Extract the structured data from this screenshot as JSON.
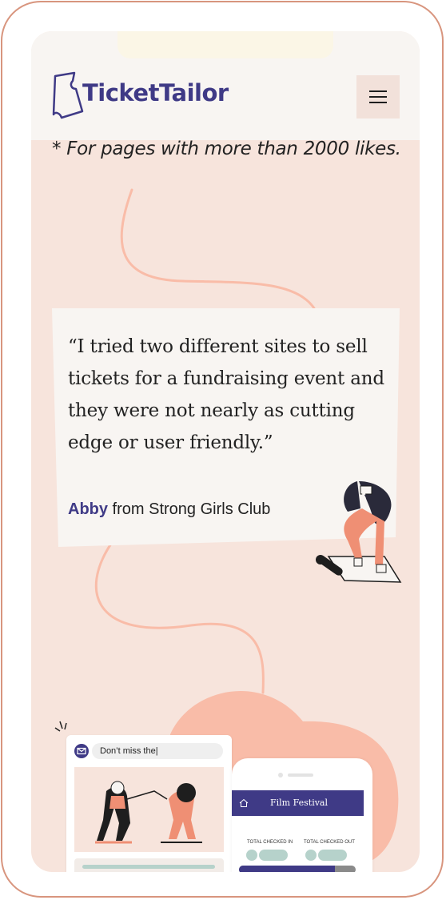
{
  "header": {
    "logo_text": "TicketTailor",
    "menu_icon": "hamburger-icon"
  },
  "footnote": "* For pages with more than 2000 likes.",
  "testimonial": {
    "quote": "“I tried two different sites to sell tickets for a fundraising event and they were not nearly as cutting edge or user friendly.”",
    "author_name": "Abby",
    "author_org": " from Strong Girls Club"
  },
  "email_preview": {
    "subject": "Don’t miss the|",
    "icon": "mail-icon"
  },
  "phone_preview": {
    "title": "Film Festival",
    "home_icon": "home-icon",
    "label_in": "TOTAL CHECKED IN",
    "label_out": "TOTAL CHECKED OUT",
    "progress": 0.82
  },
  "colors": {
    "brand": "#3f3a86",
    "background": "#f7e4dc",
    "accent": "#f9bca8",
    "teal": "#b6d2cb",
    "frame": "#d8957e"
  }
}
